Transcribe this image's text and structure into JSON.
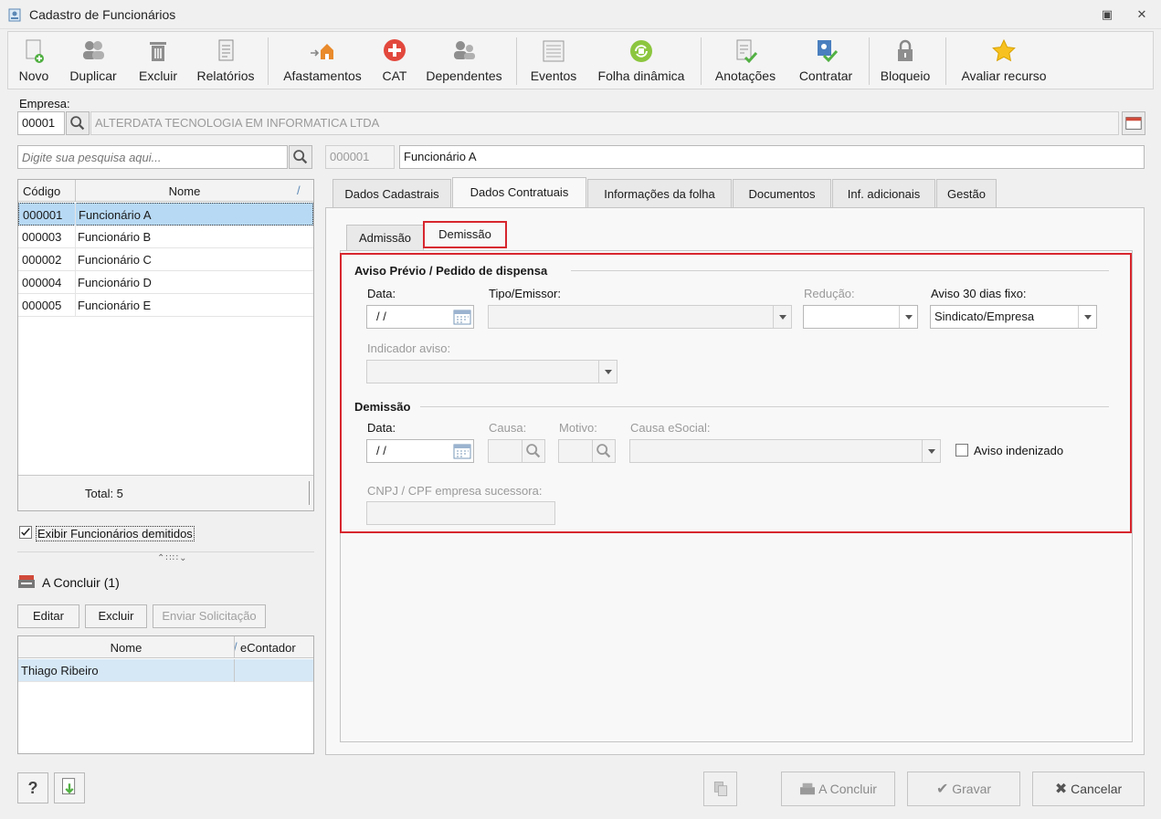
{
  "window": {
    "title": "Cadastro de Funcionários"
  },
  "toolbar": {
    "novo": "Novo",
    "duplicar": "Duplicar",
    "excluir": "Excluir",
    "relatorios": "Relatórios",
    "afastamentos": "Afastamentos",
    "cat": "CAT",
    "dependentes": "Dependentes",
    "eventos": "Eventos",
    "folha_dinamica": "Folha dinâmica",
    "anotacoes": "Anotações",
    "contratar": "Contratar",
    "bloqueio": "Bloqueio",
    "avaliar": "Avaliar recurso"
  },
  "empresa": {
    "label": "Empresa:",
    "code": "00001",
    "name": "ALTERDATA TECNOLOGIA EM INFORMATICA LTDA"
  },
  "search": {
    "placeholder": "Digite sua pesquisa aqui..."
  },
  "employee": {
    "code": "000001",
    "name": "Funcionário A"
  },
  "emp_grid": {
    "col_code": "Código",
    "col_name": "Nome",
    "rows": [
      {
        "code": "000001",
        "name": "Funcionário A"
      },
      {
        "code": "000003",
        "name": "Funcionário B"
      },
      {
        "code": "000002",
        "name": "Funcionário C"
      },
      {
        "code": "000004",
        "name": "Funcionário D"
      },
      {
        "code": "000005",
        "name": "Funcionário E"
      }
    ],
    "total": "Total: 5"
  },
  "show_dismissed": {
    "label": "Exibir Funcionários demitidos"
  },
  "a_concluir": {
    "title": "A Concluir (1)",
    "editar": "Editar",
    "excluir": "Excluir",
    "enviar": "Enviar Solicitação",
    "col_name": "Nome",
    "col_econtador": "eContador",
    "rows": [
      {
        "name": "Thiago Ribeiro",
        "econtador": ""
      }
    ]
  },
  "tabs": {
    "dados_cadastrais": "Dados Cadastrais",
    "dados_contratuais": "Dados Contratuais",
    "info_folha": "Informações da folha",
    "documentos": "Documentos",
    "inf_adicionais": "Inf. adicionais",
    "gestao": "Gestão"
  },
  "subtabs": {
    "admissao": "Admissão",
    "demissao": "Demissão"
  },
  "aviso": {
    "section": "Aviso Prévio / Pedido de dispensa",
    "data_label": "Data:",
    "data_value": "/ /",
    "tipo_label": "Tipo/Emissor:",
    "reducao_label": "Redução:",
    "aviso30_label": "Aviso 30 dias fixo:",
    "aviso30_value": "Sindicato/Empresa",
    "indicador_label": "Indicador aviso:"
  },
  "demissao": {
    "section": "Demissão",
    "data_label": "Data:",
    "data_value": "/ /",
    "causa_label": "Causa:",
    "motivo_label": "Motivo:",
    "causa_esocial_label": "Causa eSocial:",
    "aviso_indenizado": "Aviso indenizado",
    "cnpj_label": "CNPJ / CPF empresa sucessora:"
  },
  "footer": {
    "a_concluir": "A Concluir",
    "gravar": "Gravar",
    "cancelar": "Cancelar"
  },
  "colors": {
    "selection": "#b7d9f4",
    "highlight": "#d7262e"
  }
}
